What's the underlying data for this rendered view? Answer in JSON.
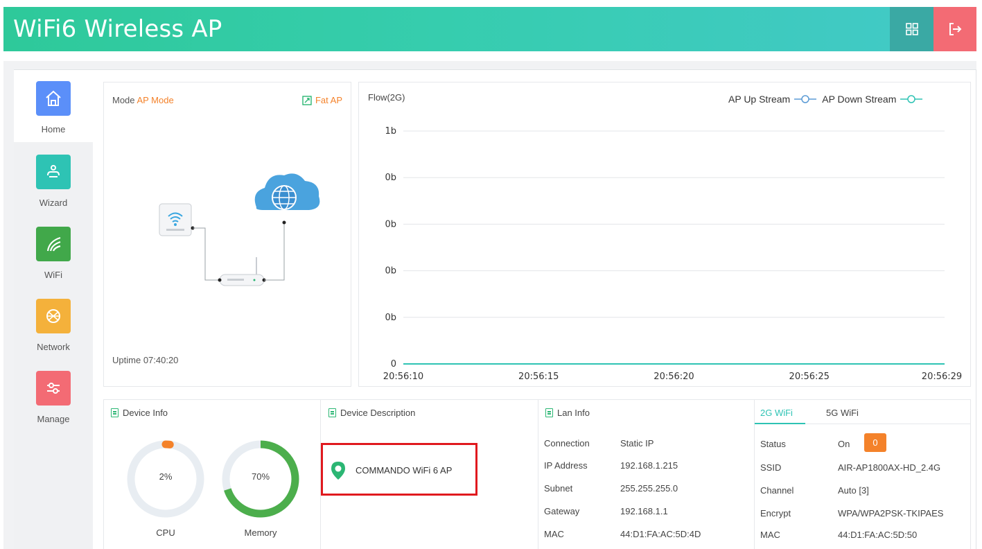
{
  "header": {
    "title": "WiFi6 Wireless AP",
    "grid_icon": "grid-icon",
    "logout_icon": "logout-icon"
  },
  "sidebar": {
    "items": [
      {
        "label": "Home",
        "icon": "home-icon",
        "color": "#5b8ff9"
      },
      {
        "label": "Wizard",
        "icon": "wizard-icon",
        "color": "#2ec3b4"
      },
      {
        "label": "WiFi",
        "icon": "wifi-icon",
        "color": "#41a84a"
      },
      {
        "label": "Network",
        "icon": "network-icon",
        "color": "#f4b13b"
      },
      {
        "label": "Manage",
        "icon": "manage-icon",
        "color": "#f36b74"
      }
    ]
  },
  "mode": {
    "label": "Mode",
    "value": "AP Mode",
    "fat_ap": "Fat AP",
    "uptime_label": "Uptime",
    "uptime": "07:40:20"
  },
  "flow": {
    "title": "Flow(2G)",
    "legend_up": "AP Up Stream",
    "legend_down": "AP Down Stream"
  },
  "chart_data": {
    "type": "line",
    "title": "Flow(2G)",
    "x": [
      "20:56:10",
      "20:56:15",
      "20:56:20",
      "20:56:25",
      "20:56:29"
    ],
    "y_ticks": [
      "1b",
      "0b",
      "0b",
      "0b",
      "0b",
      "0"
    ],
    "series": [
      {
        "name": "AP Up Stream",
        "values": [
          0,
          0,
          0,
          0,
          0
        ],
        "color": "#5b9bd5"
      },
      {
        "name": "AP Down Stream",
        "values": [
          0,
          0,
          0,
          0,
          0
        ],
        "color": "#2ec3b4"
      }
    ],
    "ylim": [
      0,
      1
    ],
    "grid": true,
    "legend": "top-right"
  },
  "device_info": {
    "title": "Device Info",
    "cpu_label": "CPU",
    "cpu_value": "2%",
    "cpu_pct": 2,
    "mem_label": "Memory",
    "mem_value": "70%",
    "mem_pct": 70
  },
  "device_desc": {
    "title": "Device Description",
    "text": "COMMANDO WiFi 6 AP"
  },
  "lan": {
    "title": "Lan Info",
    "rows": [
      {
        "k": "Connection",
        "v": "Static IP"
      },
      {
        "k": "IP Address",
        "v": "192.168.1.215"
      },
      {
        "k": "Subnet",
        "v": "255.255.255.0"
      },
      {
        "k": "Gateway",
        "v": "192.168.1.1"
      },
      {
        "k": "MAC",
        "v": "44:D1:FA:AC:5D:4D"
      }
    ]
  },
  "wifi": {
    "tab_2g": "2G WiFi",
    "tab_5g": "5G WiFi",
    "status_label": "Status",
    "status_value": "On",
    "status_badge": "0",
    "rows": [
      {
        "k": "SSID",
        "v": "AIR-AP1800AX-HD_2.4G"
      },
      {
        "k": "Channel",
        "v": "Auto [3]"
      },
      {
        "k": "Encrypt",
        "v": "WPA/WPA2PSK-TKIPAES"
      },
      {
        "k": "MAC",
        "v": "44:D1:FA:AC:5D:50"
      }
    ]
  }
}
